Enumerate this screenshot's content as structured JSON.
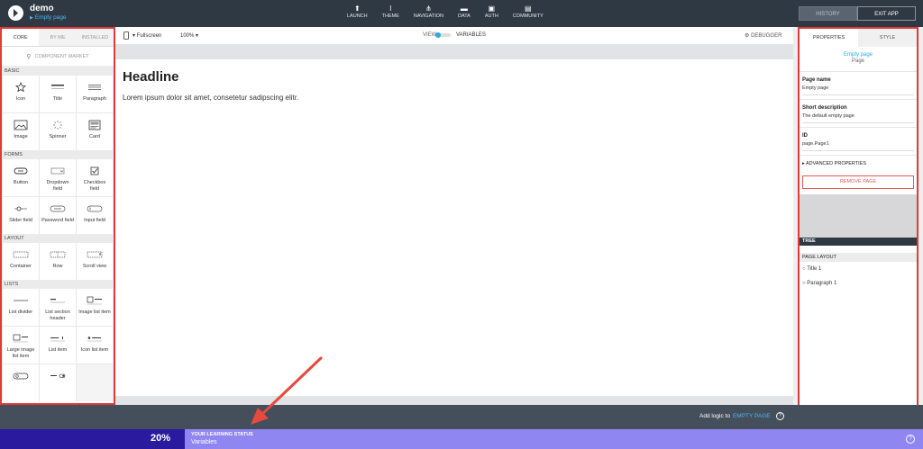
{
  "header": {
    "app_name": "demo",
    "page_crumb": "Empty page",
    "nav": [
      {
        "label": "LAUNCH",
        "icon": "upload-icon"
      },
      {
        "label": "THEME",
        "icon": "brush-icon"
      },
      {
        "label": "NAVIGATION",
        "icon": "navigation-icon"
      },
      {
        "label": "DATA",
        "icon": "folder-icon"
      },
      {
        "label": "AUTH",
        "icon": "lock-icon"
      },
      {
        "label": "COMMUNITY",
        "icon": "chat-icon"
      }
    ],
    "history_label": "HISTORY",
    "exit_label": "EXIT APP"
  },
  "left_panel": {
    "tabs": [
      "CORE",
      "BY ME",
      "INSTALLED"
    ],
    "active_tab": "CORE",
    "market_label": "COMPONENT MARKET",
    "sections": [
      {
        "title": "BASIC",
        "items": [
          "Icon",
          "Title",
          "Paragraph",
          "Image",
          "Spinner",
          "Card"
        ]
      },
      {
        "title": "FORMS",
        "items": [
          "Button",
          "Dropdown field",
          "Checkbox field",
          "Slider field",
          "Password field",
          "Input field"
        ]
      },
      {
        "title": "LAYOUT",
        "items": [
          "Container",
          "Row",
          "Scroll view"
        ]
      },
      {
        "title": "LISTS",
        "items": [
          "List divider",
          "List section header",
          "Image list item",
          "Large image list item",
          "List item",
          "Icon list item"
        ]
      }
    ]
  },
  "canvas_toolbar": {
    "device": "Fullscreen",
    "zoom": "100%",
    "view_label": "VIEW",
    "variables_label": "VARIABLES",
    "debugger_label": "DEBUGGER"
  },
  "canvas": {
    "headline": "Headline",
    "paragraph": "Lorem ipsum dolor sit amet, consetetur sadipscing elitr."
  },
  "footer": {
    "add_logic_prefix": "Add logic to",
    "add_logic_target": "EMPTY PAGE",
    "help": "?"
  },
  "right_panel": {
    "tabs": [
      "PROPERTIES",
      "STYLE"
    ],
    "active_tab": "PROPERTIES",
    "selected_name": "Empty page",
    "selected_type": "Page",
    "page_name_label": "Page name",
    "page_name_value": "Empty page",
    "short_desc_label": "Short description",
    "short_desc_value": "The default empty page",
    "id_label": "ID",
    "id_value": "page.Page1",
    "advanced_label": "ADVANCED PROPERTIES",
    "remove_label": "REMOVE PAGE",
    "tree_label": "TREE",
    "page_layout_label": "PAGE LAYOUT",
    "tree_items": [
      "Title 1",
      "Paragraph 1"
    ]
  },
  "learning": {
    "percent": "20%",
    "title": "YOUR LEARNING STATUS",
    "subtitle": "Variables",
    "help": "?"
  },
  "colors": {
    "topbar": "#2f3944",
    "accent": "#29abe2",
    "highlight_border": "#e03a3a",
    "learning_bar": "#8f86f2",
    "learning_dark": "#2a1b9e",
    "annotation_arrow": "#e8493d"
  }
}
